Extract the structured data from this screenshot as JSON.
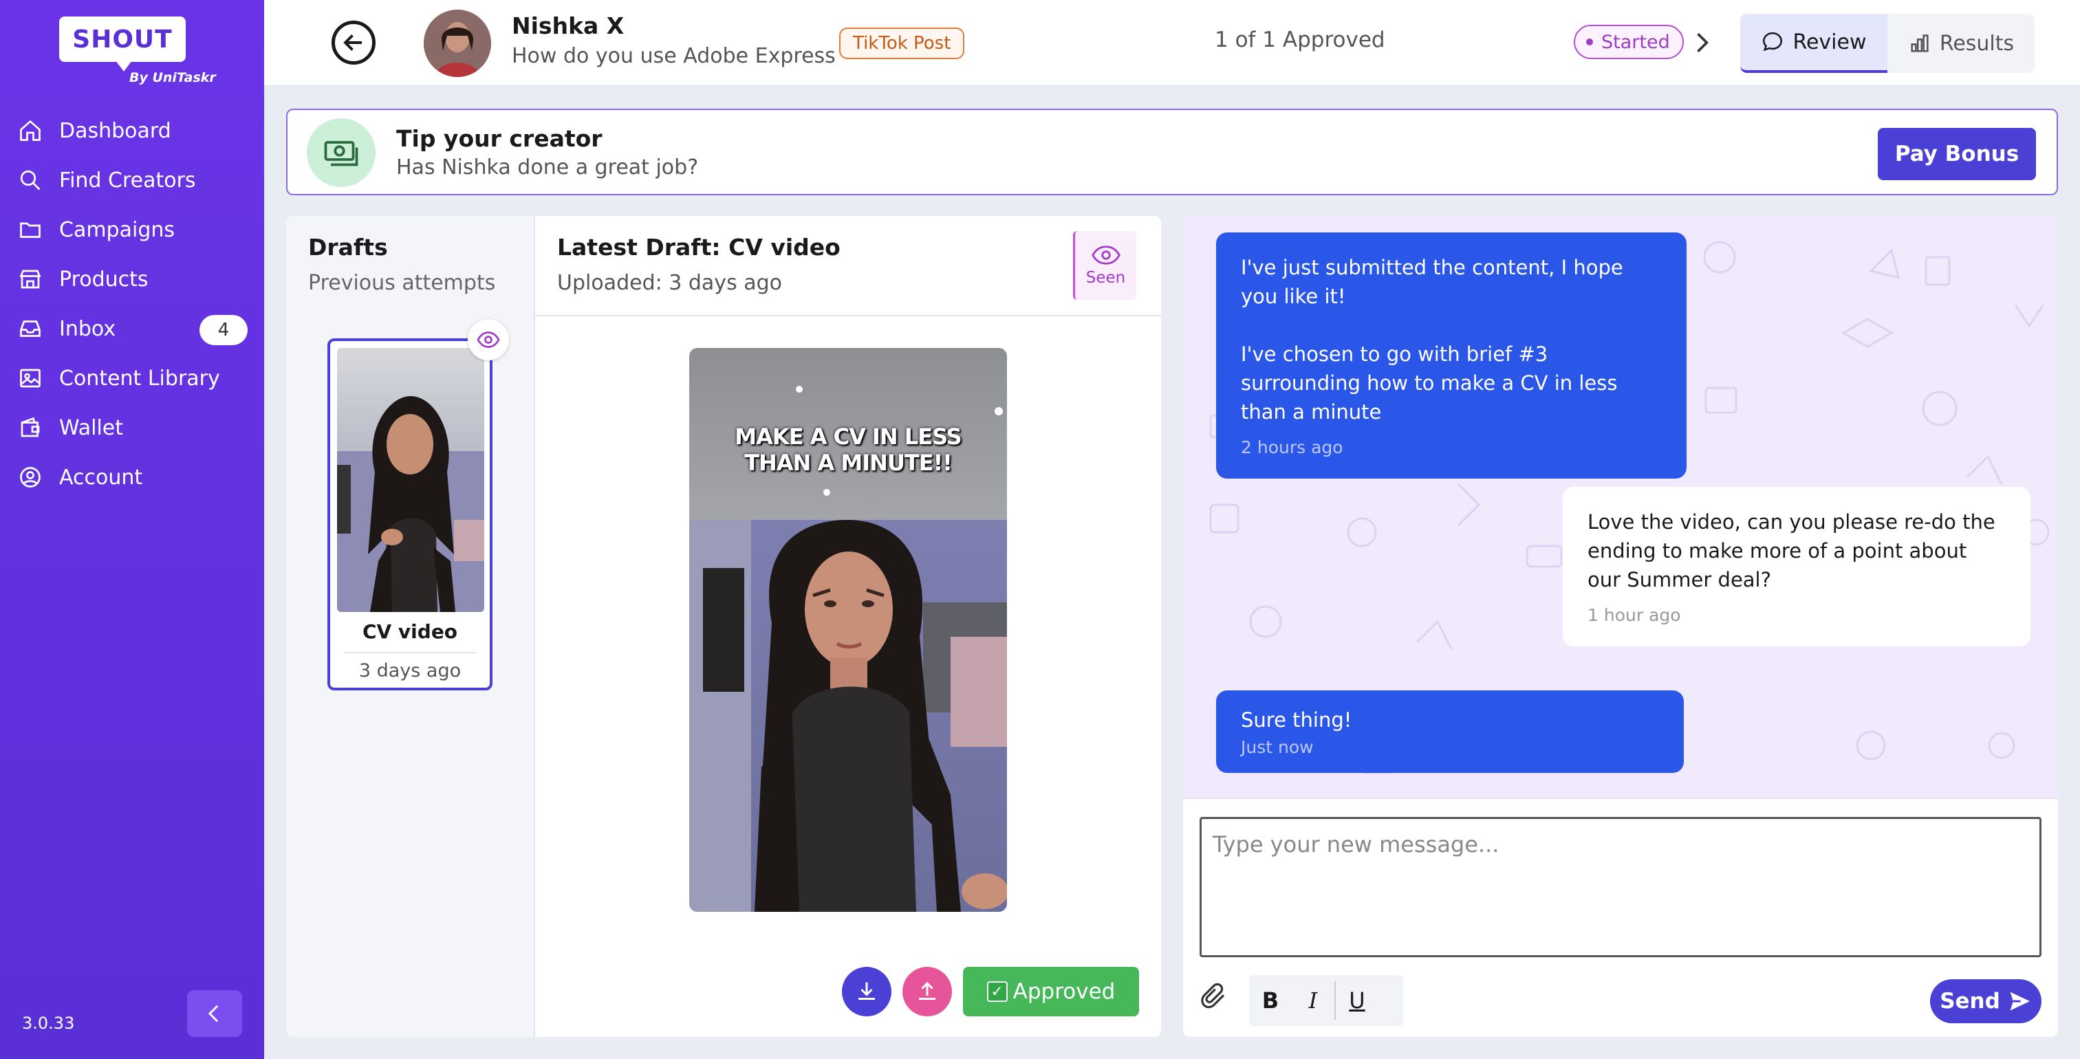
{
  "brand": {
    "logo": "SHOUT",
    "sub": "By UniTaskr"
  },
  "sidebar": {
    "items": [
      {
        "label": "Dashboard",
        "icon": "home-icon"
      },
      {
        "label": "Find Creators",
        "icon": "search-icon"
      },
      {
        "label": "Campaigns",
        "icon": "folder-icon"
      },
      {
        "label": "Products",
        "icon": "store-icon"
      },
      {
        "label": "Inbox",
        "icon": "inbox-icon",
        "badge": "4"
      },
      {
        "label": "Content Library",
        "icon": "image-icon"
      },
      {
        "label": "Wallet",
        "icon": "wallet-icon"
      },
      {
        "label": "Account",
        "icon": "account-icon"
      }
    ],
    "version": "3.0.33"
  },
  "header": {
    "creator_name": "Nishka X",
    "campaign": "How do you use Adobe Express",
    "post_type": "TikTok Post",
    "approved_count": "1 of 1 Approved",
    "status": "Started",
    "tabs": [
      {
        "label": "Review",
        "active": true
      },
      {
        "label": "Results",
        "active": false
      }
    ]
  },
  "tip": {
    "title": "Tip your creator",
    "subtitle": "Has Nishka done a great job?",
    "button": "Pay Bonus"
  },
  "drafts": {
    "title": "Drafts",
    "subtitle": "Previous attempts",
    "items": [
      {
        "name": "CV video",
        "date": "3 days ago"
      }
    ]
  },
  "latest": {
    "title": "Latest Draft: CV video",
    "uploaded": "Uploaded: 3 days ago",
    "seen_label": "Seen",
    "caption_line1": "MAKE A CV IN LESS",
    "caption_line2": "THAN A MINUTE!!",
    "approved_label": "Approved"
  },
  "chat": {
    "messages": [
      {
        "from": "creator",
        "lines": [
          "I've just submitted the content, I hope you like it!",
          "I've chosen to go with brief #3 surrounding how to make a CV in less than a minute"
        ],
        "time": "2 hours ago"
      },
      {
        "from": "brand",
        "lines": [
          "Love the video, can you please re-do the ending to make more of a point about our Summer deal?"
        ],
        "time": "1 hour ago"
      },
      {
        "from": "creator",
        "lines": [
          "Sure thing!"
        ],
        "time": "Just now"
      }
    ],
    "placeholder": "Type your new message...",
    "format": {
      "bold": "B",
      "italic": "I",
      "underline": "U"
    },
    "send_label": "Send"
  },
  "colors": {
    "accent": "#4a40d6",
    "sidebar": "#5a2fd6",
    "creator_bubble": "#2b57e8",
    "approved": "#46b85a",
    "upload": "#e6559a"
  }
}
